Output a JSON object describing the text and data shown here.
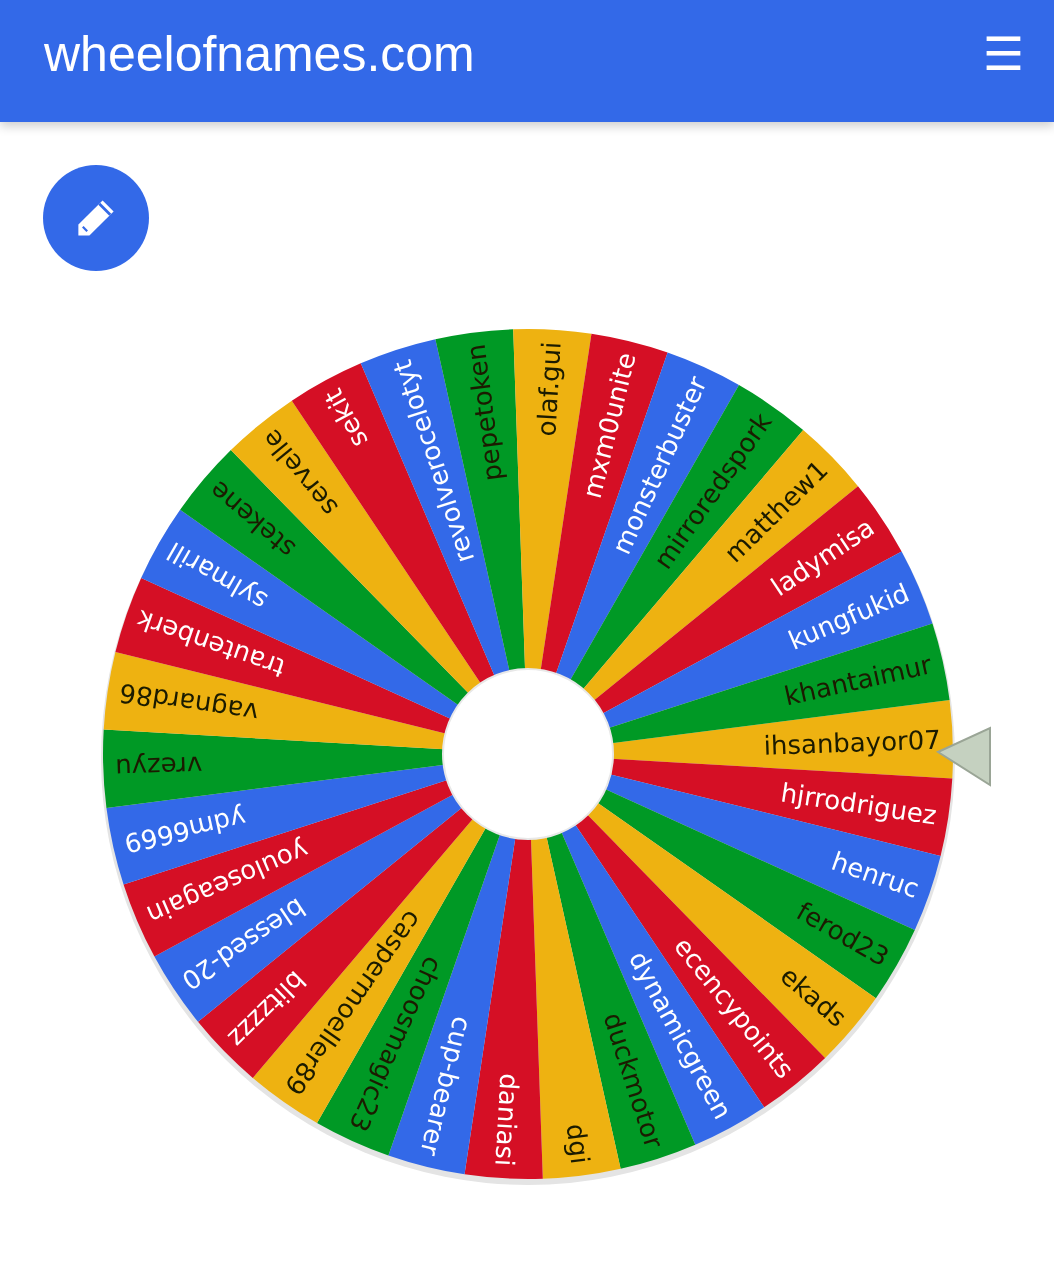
{
  "header": {
    "title": "wheelofnames.com",
    "menu_icon": "☰"
  },
  "wheel": {
    "slices": [
      {
        "name": "ihsanbayor07",
        "color": "#eeb211"
      },
      {
        "name": "hjrrodriguez",
        "color": "#d50f25"
      },
      {
        "name": "henruc",
        "color": "#3369e8"
      },
      {
        "name": "ferod23",
        "color": "#009925"
      },
      {
        "name": "ekads",
        "color": "#eeb211"
      },
      {
        "name": "ecencypoints",
        "color": "#d50f25"
      },
      {
        "name": "dynamicgreen",
        "color": "#3369e8"
      },
      {
        "name": "duckmotor",
        "color": "#009925"
      },
      {
        "name": "dgi",
        "color": "#eeb211"
      },
      {
        "name": "daniasi",
        "color": "#d50f25"
      },
      {
        "name": "cup-bearer",
        "color": "#3369e8"
      },
      {
        "name": "choosmagic23",
        "color": "#009925"
      },
      {
        "name": "caspermoeller89",
        "color": "#eeb211"
      },
      {
        "name": "blitzzzz",
        "color": "#d50f25"
      },
      {
        "name": "blessed-20",
        "color": "#3369e8"
      },
      {
        "name": "youloseagain",
        "color": "#d50f25"
      },
      {
        "name": "ydm6669",
        "color": "#3369e8"
      },
      {
        "name": "vrezyu",
        "color": "#009925"
      },
      {
        "name": "vagnard86",
        "color": "#eeb211"
      },
      {
        "name": "trautenberk",
        "color": "#d50f25"
      },
      {
        "name": "sylmarill",
        "color": "#3369e8"
      },
      {
        "name": "stekene",
        "color": "#009925"
      },
      {
        "name": "servelle",
        "color": "#eeb211"
      },
      {
        "name": "sekit",
        "color": "#d50f25"
      },
      {
        "name": "revolverocelotyt",
        "color": "#3369e8"
      },
      {
        "name": "pepetoken",
        "color": "#009925"
      },
      {
        "name": "olaf.gui",
        "color": "#eeb211"
      },
      {
        "name": "mxm0unite",
        "color": "#d50f25"
      },
      {
        "name": "monsterbuster",
        "color": "#3369e8"
      },
      {
        "name": "mirroredspork",
        "color": "#009925"
      },
      {
        "name": "matthew1",
        "color": "#eeb211"
      },
      {
        "name": "ladymisa",
        "color": "#d50f25"
      },
      {
        "name": "kungfukid",
        "color": "#3369e8"
      },
      {
        "name": "khantaimur",
        "color": "#009925"
      }
    ]
  }
}
